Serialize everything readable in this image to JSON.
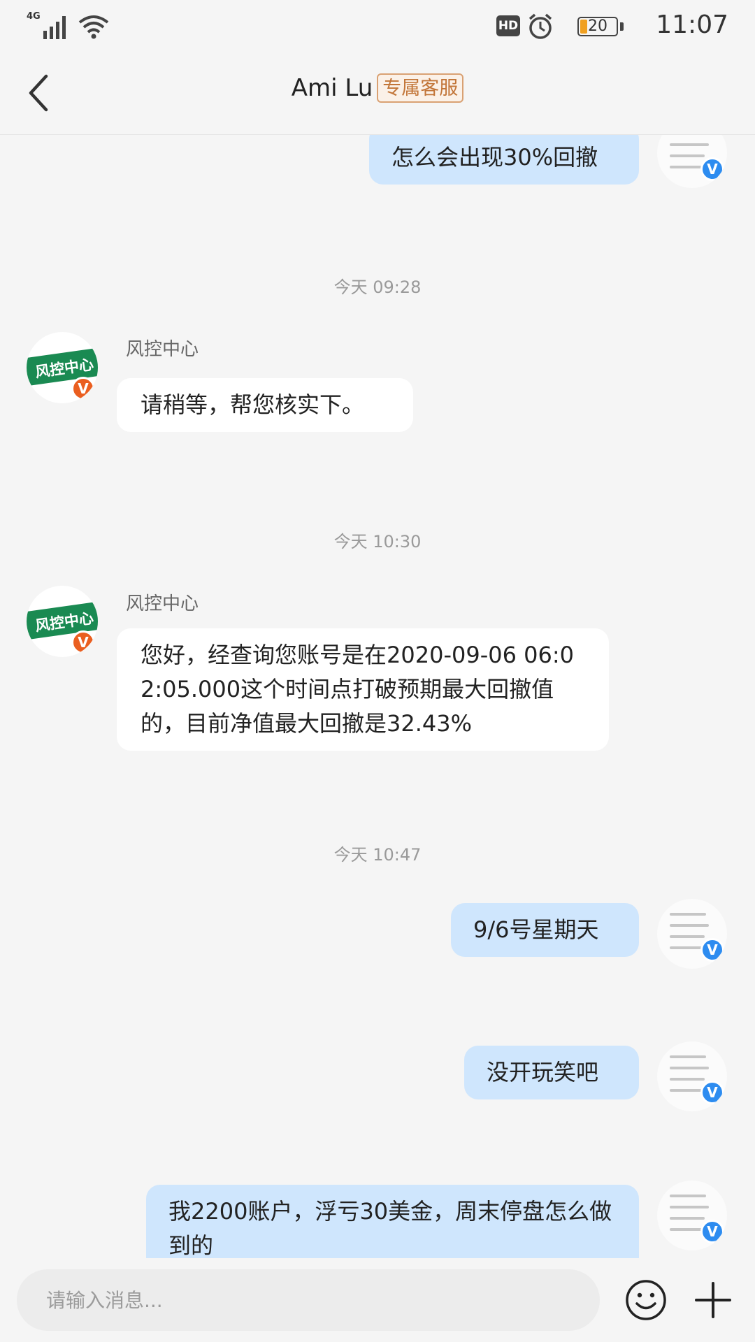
{
  "status_bar": {
    "network": "4G",
    "hd": "HD",
    "battery": "20",
    "time": "11:07"
  },
  "header": {
    "title": "Ami Lu",
    "badge": "专属客服"
  },
  "chat": {
    "messages": [
      {
        "type": "out",
        "text": "怎么会出现30%回撤"
      },
      {
        "type": "time",
        "text": "今天 09:28"
      },
      {
        "type": "in",
        "sender": "风控中心",
        "text": "请稍等，帮您核实下。"
      },
      {
        "type": "time",
        "text": "今天 10:30"
      },
      {
        "type": "in",
        "sender": "风控中心",
        "text": "您好，经查询您账号是在2020-09-06 06:02:05.000这个时间点打破预期最大回撤值的，目前净值最大回撤是32.43%"
      },
      {
        "type": "time",
        "text": "今天 10:47"
      },
      {
        "type": "out",
        "text": "9/6号星期天"
      },
      {
        "type": "out",
        "text": "没开玩笑吧"
      },
      {
        "type": "out",
        "text": "我2200账户，浮亏30美金，周末停盘怎么做到的"
      }
    ],
    "agent_avatar_text": "风控中心",
    "verified_mark": "V"
  },
  "input_bar": {
    "placeholder": "请输入消息..."
  },
  "colors": {
    "accent_badge": "#c27538",
    "bubble_out": "#cfe6fd",
    "agent_green": "#1a8a52",
    "verified_blue": "#2d8cf0",
    "verified_orange": "#ea5e1f"
  },
  "icons": {
    "back": "chevron-left-icon",
    "emoji": "smiley-icon",
    "plus": "plus-icon"
  }
}
